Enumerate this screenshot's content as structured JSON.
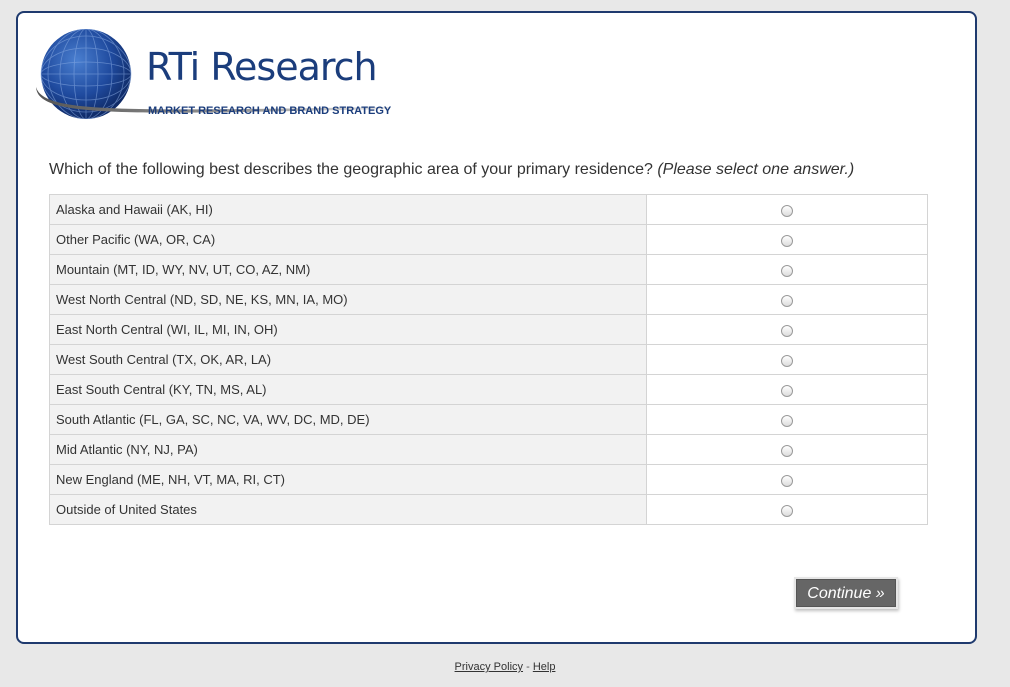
{
  "logo": {
    "name": "RTi Research",
    "tagline": "MARKET RESEARCH AND BRAND STRATEGY"
  },
  "question": {
    "text": "Which of the following best describes the geographic area of your primary residence?",
    "instruction": "(Please select one answer.)"
  },
  "options": [
    {
      "label": "Alaska and Hawaii (AK, HI)"
    },
    {
      "label": "Other Pacific (WA, OR, CA)"
    },
    {
      "label": "Mountain (MT, ID, WY, NV, UT, CO, AZ, NM)"
    },
    {
      "label": "West North Central (ND, SD, NE, KS, MN, IA, MO)"
    },
    {
      "label": "East North Central (WI, IL, MI, IN, OH)"
    },
    {
      "label": "West South Central (TX, OK, AR, LA)"
    },
    {
      "label": "East South Central (KY, TN, MS, AL)"
    },
    {
      "label": "South Atlantic (FL, GA, SC, NC, VA, WV, DC, MD, DE)"
    },
    {
      "label": "Mid Atlantic (NY, NJ, PA)"
    },
    {
      "label": "New England (ME, NH, VT, MA, RI, CT)"
    },
    {
      "label": "Outside of United States"
    }
  ],
  "continue_label": "Continue »",
  "footer": {
    "privacy": "Privacy Policy",
    "separator": "-",
    "help": "Help"
  },
  "colors": {
    "brand": "#1b3d7c",
    "border": "#1f3a6e",
    "button": "#666666"
  }
}
